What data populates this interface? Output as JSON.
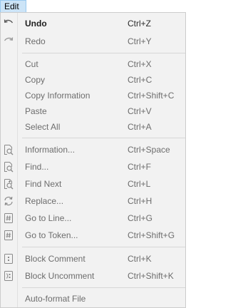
{
  "menubar": {
    "edit_label": "Edit"
  },
  "menu": {
    "undo": {
      "label": "Undo",
      "shortcut": "Ctrl+Z",
      "icon": "undo-icon"
    },
    "redo": {
      "label": "Redo",
      "shortcut": "Ctrl+Y",
      "icon": "redo-icon"
    },
    "cut": {
      "label": "Cut",
      "shortcut": "Ctrl+X"
    },
    "copy": {
      "label": "Copy",
      "shortcut": "Ctrl+C"
    },
    "copy_information": {
      "label": "Copy Information",
      "shortcut": "Ctrl+Shift+C"
    },
    "paste": {
      "label": "Paste",
      "shortcut": "Ctrl+V"
    },
    "select_all": {
      "label": "Select All",
      "shortcut": "Ctrl+A"
    },
    "information": {
      "label": "Information...",
      "shortcut": "Ctrl+Space",
      "icon": "information-search-icon"
    },
    "find": {
      "label": "Find...",
      "shortcut": "Ctrl+F",
      "icon": "find-icon"
    },
    "find_next": {
      "label": "Find Next",
      "shortcut": "Ctrl+L",
      "icon": "find-next-icon"
    },
    "replace": {
      "label": "Replace...",
      "shortcut": "Ctrl+H",
      "icon": "replace-icon"
    },
    "go_to_line": {
      "label": "Go to Line...",
      "shortcut": "Ctrl+G",
      "icon": "hash-icon"
    },
    "go_to_token": {
      "label": "Go to Token...",
      "shortcut": "Ctrl+Shift+G",
      "icon": "hash-token-icon"
    },
    "block_comment": {
      "label": "Block Comment",
      "shortcut": "Ctrl+K",
      "icon": "block-comment-icon"
    },
    "block_uncomment": {
      "label": "Block Uncomment",
      "shortcut": "Ctrl+Shift+K",
      "icon": "block-uncomment-icon"
    },
    "auto_format": {
      "label": "Auto-format File"
    }
  }
}
